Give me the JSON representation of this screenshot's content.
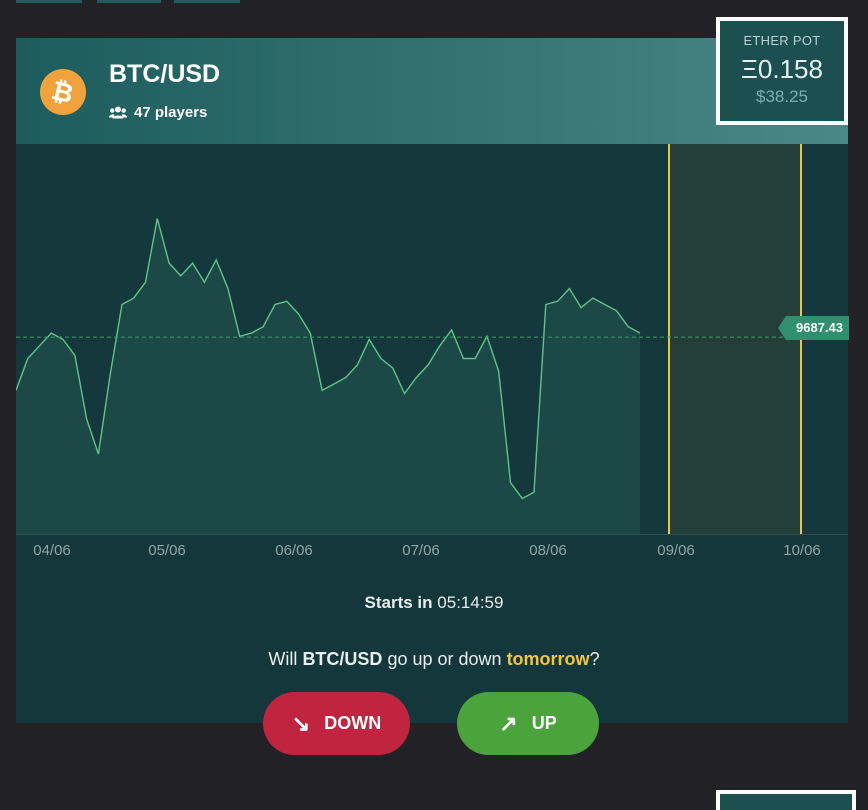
{
  "pair": "BTC/USD",
  "coin_symbol": "₿",
  "players": "47 players",
  "pot": {
    "label": "ETHER POT",
    "eth": "Ξ0.158",
    "usd": "$38.25"
  },
  "current_price": "9687.43",
  "colors": {
    "accent_yellow": "#f3c443",
    "down_red": "#c0243f",
    "up_green": "#4aa43b",
    "line_green": "#5fc48a"
  },
  "chart_data": {
    "type": "line",
    "x": [
      "04/06",
      "05/06",
      "06/06",
      "07/06",
      "08/06",
      "09/06",
      "10/06"
    ],
    "xlabel": "",
    "ylabel": "",
    "reference_line": 9687.43,
    "series": [
      {
        "values": [
          9520,
          9620,
          9660,
          9700,
          9680,
          9630,
          9430,
          9320,
          9570,
          9790,
          9810,
          9860,
          10060,
          9920,
          9880,
          9920,
          9860,
          9930,
          9840,
          9690,
          9700,
          9720,
          9790,
          9800,
          9760,
          9700,
          9520,
          9540,
          9560,
          9600,
          9680,
          9620,
          9590,
          9510,
          9560,
          9600,
          9660,
          9710,
          9620,
          9620,
          9690,
          9580,
          9230,
          9180,
          9200,
          9790,
          9800,
          9840,
          9780,
          9810,
          9790,
          9770,
          9720,
          9700
        ]
      }
    ],
    "highlight_band": [
      "09/06",
      "10/06"
    ]
  },
  "status": {
    "starts_label": "Starts in",
    "countdown": "05:14:59"
  },
  "question": {
    "prefix": "Will",
    "pair": "BTC/USD",
    "middle": "go up or down",
    "highlight": "tomorrow",
    "suffix": "?"
  },
  "buttons": {
    "down": "DOWN",
    "up": "UP",
    "down_icon": "↘",
    "up_icon": "↗"
  }
}
